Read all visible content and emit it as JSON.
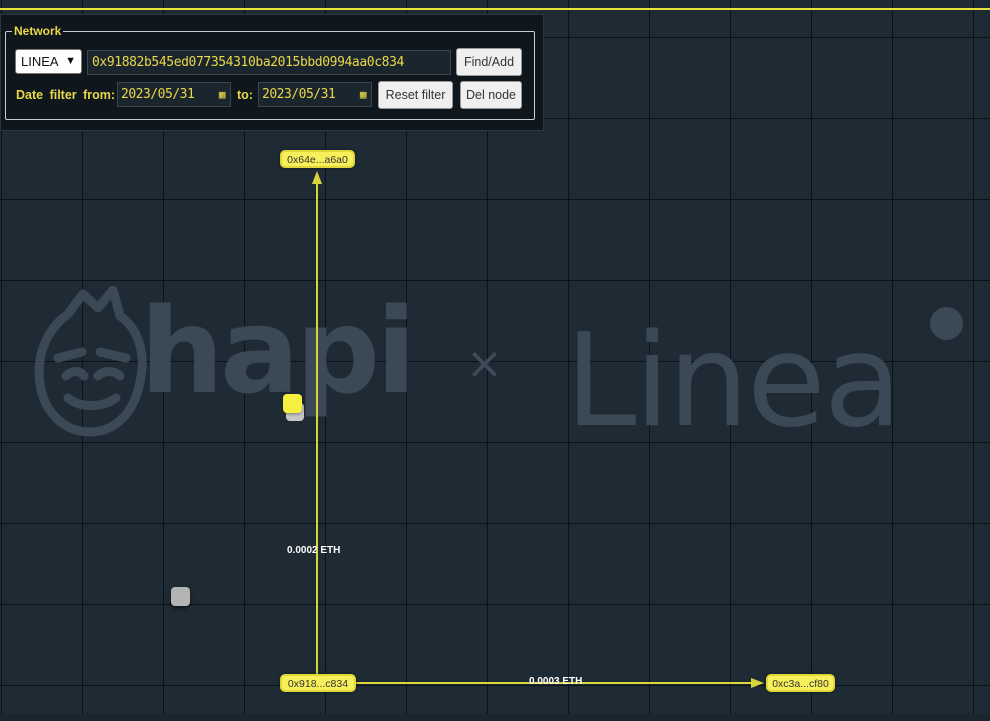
{
  "panel": {
    "legend": "Network",
    "network": {
      "selected": "LINEA"
    },
    "address": {
      "value": "0x91882b545ed077354310ba2015bbd0994aa0c834"
    },
    "find_add_label": "Find/Add",
    "date_filter_from_label": "Date filter from:",
    "date_to_label": "to:",
    "date_from": "2023/05/31",
    "date_to": "2023/05/31",
    "reset_filter_label": "Reset filter",
    "del_node_label": "Del node"
  },
  "graph": {
    "nodes": {
      "top": "0x64e...a6a0",
      "source": "0x918...c834",
      "right": "0xc3a...cf80"
    },
    "edges": {
      "up": "0.0002 ETH",
      "right": "0.0003 ETH"
    }
  },
  "watermark": {
    "left": "hapi",
    "separator": "×",
    "right": "Linea"
  },
  "colors": {
    "background": "#1f2b34",
    "accent_yellow": "#e8d84a",
    "node_yellow": "#f7f05a",
    "watermark": "#3a4955"
  },
  "icons": [
    "chevron-down-icon",
    "calendar-icon",
    "arrow-head-icon"
  ]
}
